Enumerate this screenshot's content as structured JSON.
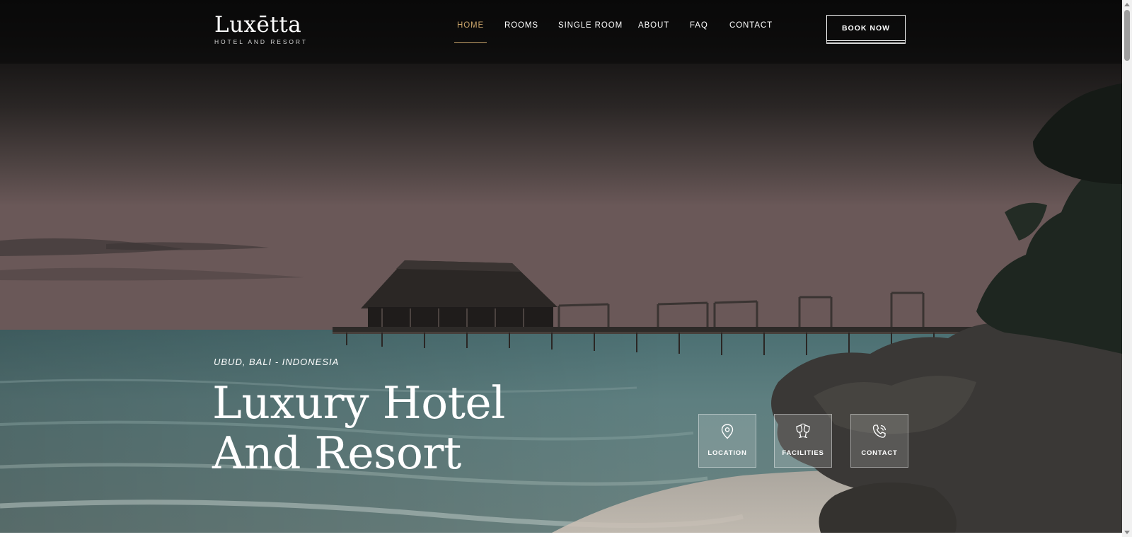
{
  "brand": {
    "name": "Luxētta",
    "tagline": "HOTEL AND RESORT"
  },
  "nav": {
    "items": [
      {
        "label": "HOME",
        "active": true
      },
      {
        "label": "ROOMS",
        "active": false
      },
      {
        "label": "SINGLE ROOM",
        "active": false
      },
      {
        "label": "ABOUT",
        "active": false
      },
      {
        "label": "FAQ",
        "active": false
      },
      {
        "label": "CONTACT",
        "active": false
      }
    ],
    "book_label": "BOOK NOW"
  },
  "hero": {
    "eyebrow": "UBUD, BALI - INDONESIA",
    "title_line1": "Luxury Hotel",
    "title_line2": "And Resort"
  },
  "cards": [
    {
      "label": "LOCATION",
      "icon": "map-pin-icon"
    },
    {
      "label": "FACILITIES",
      "icon": "cheers-glasses-icon"
    },
    {
      "label": "CONTACT",
      "icon": "phone-call-icon"
    }
  ],
  "colors": {
    "accent": "#c9a46a",
    "header_bg": "#0a0a0a",
    "text": "#ffffff"
  }
}
